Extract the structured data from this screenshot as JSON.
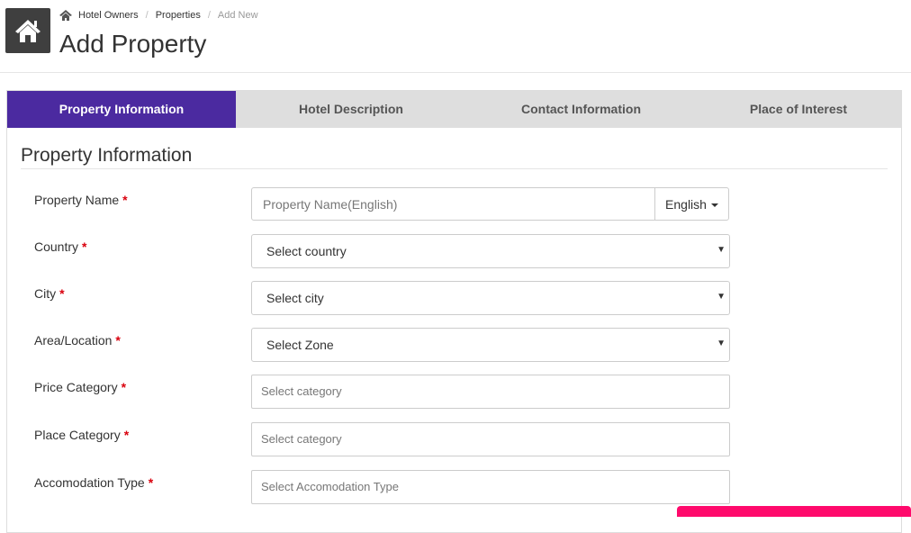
{
  "breadcrumb": {
    "items": [
      "Hotel Owners",
      "Properties"
    ],
    "current": "Add New",
    "separator": "/"
  },
  "page_title": "Add Property",
  "tabs": [
    {
      "label": "Property Information",
      "active": true
    },
    {
      "label": "Hotel Description",
      "active": false
    },
    {
      "label": "Contact Information",
      "active": false
    },
    {
      "label": "Place of Interest",
      "active": false
    }
  ],
  "section_title": "Property Information",
  "required_marker": "*",
  "form": {
    "property_name": {
      "label": "Property Name",
      "placeholder": "Property Name(English)",
      "value": "",
      "language": "English"
    },
    "country": {
      "label": "Country",
      "value": "Select country"
    },
    "city": {
      "label": "City",
      "value": "Select city"
    },
    "area": {
      "label": "Area/Location",
      "value": "Select Zone"
    },
    "price_category": {
      "label": "Price Category",
      "placeholder": "Select category"
    },
    "place_category": {
      "label": "Place Category",
      "placeholder": "Select category"
    },
    "accommodation_type": {
      "label": "Accomodation Type",
      "placeholder": "Select Accomodation Type"
    }
  },
  "colors": {
    "active_tab": "#4b2aa0",
    "tab_bar": "#dedede",
    "home_box": "#3f3f3f",
    "required": "#d9000d",
    "floating_bar": "#ff0a6c"
  },
  "icons": {
    "home": "home-icon",
    "breadcrumb_home": "breadcrumb-home-icon",
    "select_arrow": "chevron-down-icon"
  }
}
